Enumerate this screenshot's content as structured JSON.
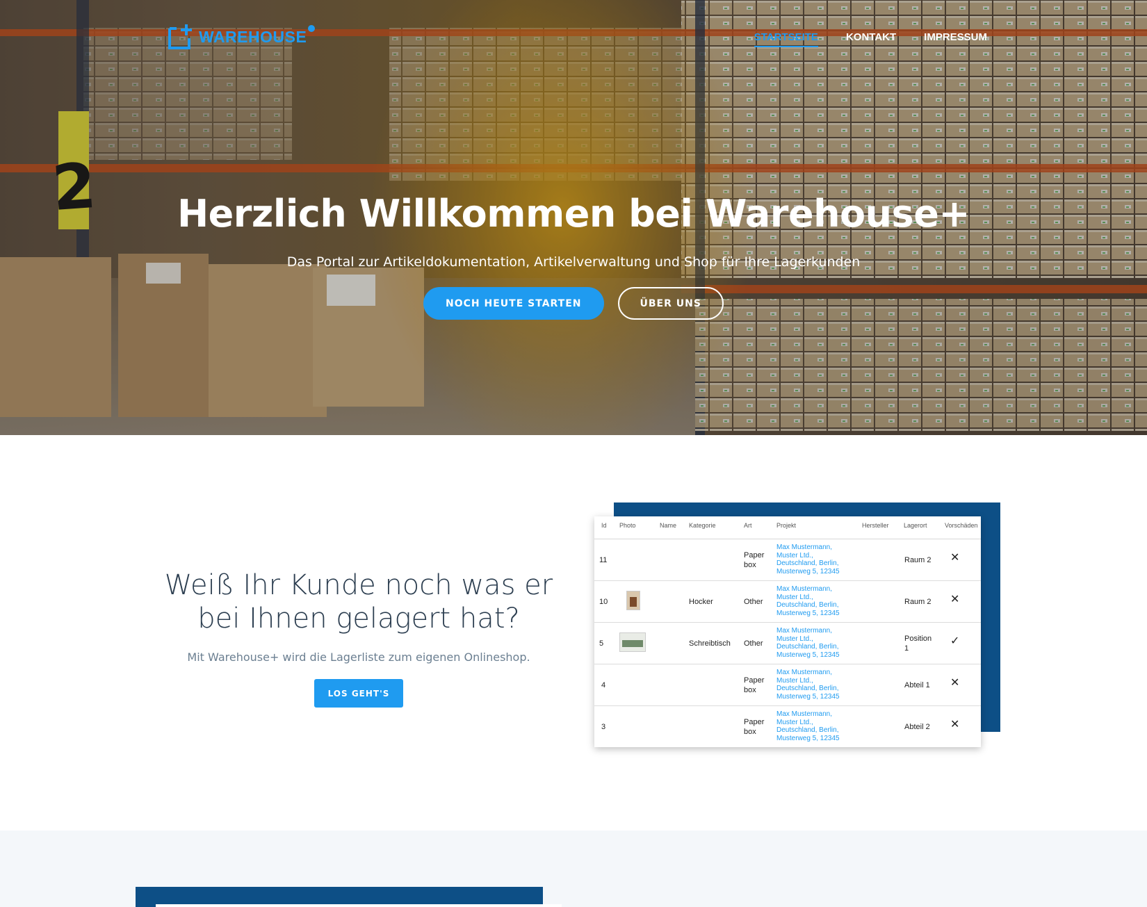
{
  "brand": {
    "name": "WAREHOUSE",
    "accent": "#1f9bf0",
    "dark_blue": "#0d4f86"
  },
  "nav": {
    "items": [
      {
        "label": "STARTSEITE",
        "active": true
      },
      {
        "label": "KONTAKT",
        "active": false
      },
      {
        "label": "IMPRESSUM",
        "active": false
      }
    ]
  },
  "hero": {
    "title": "Herzlich Willkommen bei Warehouse+",
    "subtitle": "Das Portal zur Artikeldokumentation, Artikelverwaltung und Shop für Ihre Lagerkunden",
    "primary_button": "NOCH HEUTE STARTEN",
    "secondary_button": "ÜBER UNS"
  },
  "feature": {
    "heading_line1": "Weiß Ihr Kunde noch was er",
    "heading_line2": "bei Ihnen gelagert hat?",
    "subtext": "Mit Warehouse+ wird die Lagerliste zum eigenen Onlineshop.",
    "button": "LOS GEHT'S"
  },
  "table": {
    "columns": [
      "Id",
      "Photo",
      "Name",
      "Kategorie",
      "Art",
      "Projekt",
      "Hersteller",
      "Lagerort",
      "Vorschäden"
    ],
    "rows": [
      {
        "id": "11",
        "photo": "",
        "kategorie": "",
        "art1": "Paper",
        "art2": "box",
        "projekt": [
          "Max Mustermann,",
          "Muster Ltd.,",
          "Deutschland, Berlin,",
          "Musterweg 5, 12345"
        ],
        "lager1": "Raum 2",
        "lager2": "",
        "vorschaden": "✕"
      },
      {
        "id": "10",
        "photo": "chair",
        "kategorie": "Hocker",
        "art1": "Other",
        "art2": "",
        "projekt": [
          "Max Mustermann,",
          "Muster Ltd.,",
          "Deutschland, Berlin,",
          "Musterweg 5, 12345"
        ],
        "lager1": "Raum 2",
        "lager2": "",
        "vorschaden": "✕"
      },
      {
        "id": "5",
        "photo": "desk",
        "kategorie": "Schreibtisch",
        "art1": "Other",
        "art2": "",
        "projekt": [
          "Max Mustermann,",
          "Muster Ltd.,",
          "Deutschland, Berlin,",
          "Musterweg 5, 12345"
        ],
        "lager1": "Position",
        "lager2": "1",
        "vorschaden": "✓"
      },
      {
        "id": "4",
        "photo": "",
        "kategorie": "",
        "art1": "Paper",
        "art2": "box",
        "projekt": [
          "Max Mustermann,",
          "Muster Ltd.,",
          "Deutschland, Berlin,",
          "Musterweg 5, 12345"
        ],
        "lager1": "Abteil 1",
        "lager2": "",
        "vorschaden": "✕"
      },
      {
        "id": "3",
        "photo": "",
        "kategorie": "",
        "art1": "Paper",
        "art2": "box",
        "projekt": [
          "Max Mustermann,",
          "Muster Ltd.,",
          "Deutschland, Berlin,",
          "Musterweg 5, 12345"
        ],
        "lager1": "Abteil 2",
        "lager2": "",
        "vorschaden": "✕"
      }
    ]
  }
}
